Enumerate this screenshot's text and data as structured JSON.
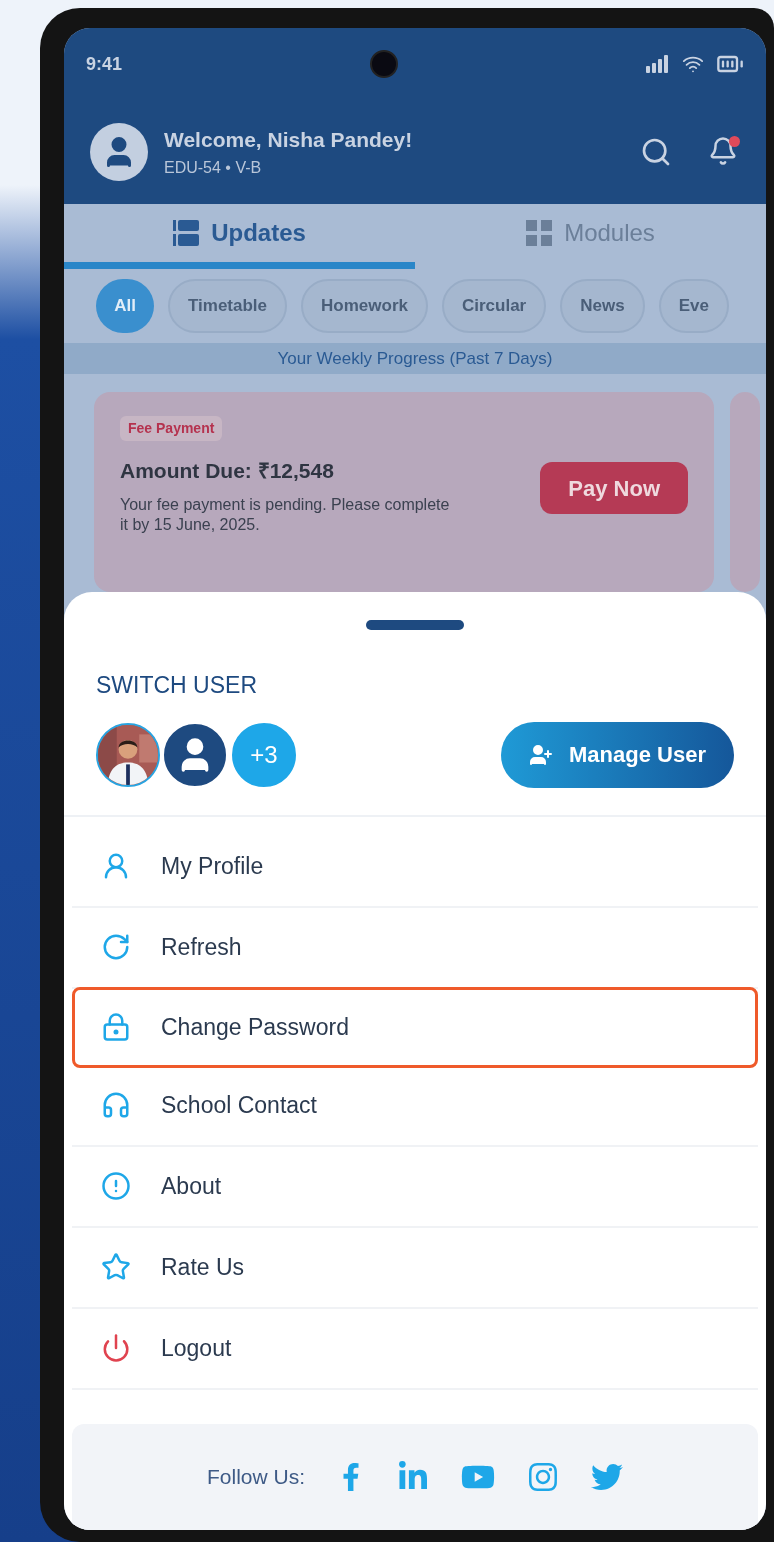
{
  "status_bar": {
    "time": "9:41"
  },
  "header": {
    "title": "Welcome, Nisha Pandey!",
    "subtitle": "EDU-54 • V-B",
    "notification_badge": true
  },
  "tabs": [
    {
      "label": "Updates",
      "selected": true
    },
    {
      "label": "Modules",
      "selected": false
    }
  ],
  "filters": [
    {
      "label": "All",
      "selected": true
    },
    {
      "label": "Timetable",
      "selected": false
    },
    {
      "label": "Homework",
      "selected": false
    },
    {
      "label": "Circular",
      "selected": false
    },
    {
      "label": "News",
      "selected": false
    },
    {
      "label": "Eve",
      "selected": false
    }
  ],
  "progress_banner": "Your Weekly Progress (Past 7 Days)",
  "card": {
    "tag": "Fee Payment",
    "title": "Amount Due: ₹12,548",
    "description": "Your fee payment is pending. Please complete it by 15 June, 2025.",
    "action": "Pay Now"
  },
  "sheet": {
    "title": "SWITCH USER",
    "more_users": "+3",
    "manage_button": "Manage User",
    "menu": [
      {
        "label": "My Profile",
        "kind": "normal",
        "selected": false
      },
      {
        "label": "Refresh",
        "kind": "normal",
        "selected": false
      },
      {
        "label": "Change Password",
        "kind": "normal",
        "selected": true
      },
      {
        "label": "School Contact",
        "kind": "normal",
        "selected": false
      },
      {
        "label": "About",
        "kind": "normal",
        "selected": false
      },
      {
        "label": "Rate Us",
        "kind": "normal",
        "selected": false
      },
      {
        "label": "Logout",
        "kind": "danger",
        "selected": false
      }
    ]
  },
  "footer": {
    "label": "Follow Us:"
  }
}
